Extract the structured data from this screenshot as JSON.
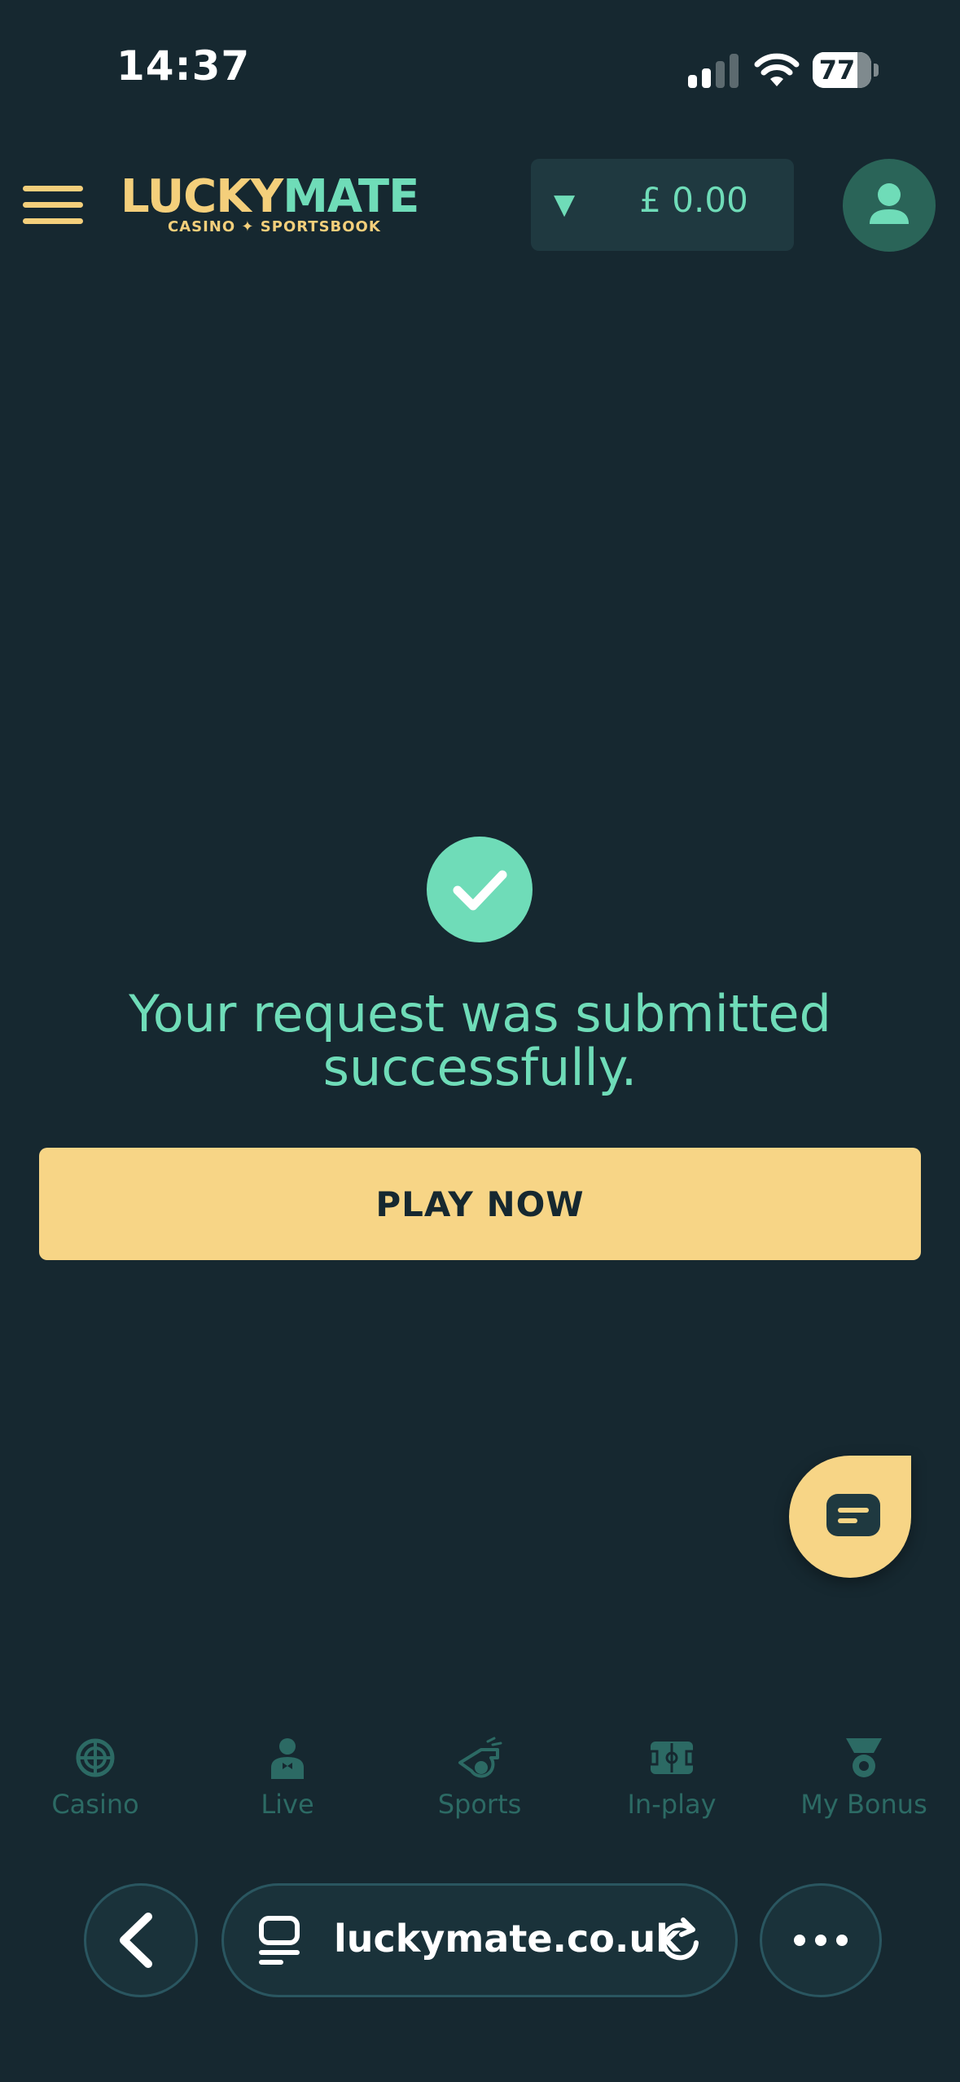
{
  "status_bar": {
    "time": "14:37",
    "battery_level": "77",
    "battery_fraction": 0.77,
    "icons": [
      "signal-icon",
      "wifi-icon",
      "battery-icon"
    ]
  },
  "header": {
    "menu_icon": "hamburger-menu-icon",
    "logo": {
      "lucky": "LUCKY",
      "mate": "MATE",
      "tagline": "CASINO ✦ SPORTSBOOK"
    },
    "balance": {
      "caret": "▼",
      "amount": "£ 0.00"
    },
    "profile_icon": "user-icon"
  },
  "main": {
    "success_icon": "checkmark-icon",
    "message": "Your request was submitted successfully.",
    "play_button": "PLAY NOW"
  },
  "chat": {
    "icon": "chat-icon"
  },
  "bottom_nav": {
    "items": [
      {
        "label": "Casino",
        "icon": "roulette-icon"
      },
      {
        "label": "Live",
        "icon": "dealer-icon"
      },
      {
        "label": "Sports",
        "icon": "whistle-icon"
      },
      {
        "label": "In-play",
        "icon": "pitch-icon"
      },
      {
        "label": "My Bonus",
        "icon": "medal-icon"
      }
    ]
  },
  "browser": {
    "url": "luckymate.co.uk",
    "icons": [
      "back-icon",
      "tabs-icon",
      "reload-icon",
      "more-icon"
    ]
  },
  "colors": {
    "background": "#162830",
    "accent_green": "#6fdcb8",
    "accent_yellow": "#f7d586",
    "nav_inactive": "#2c6a64"
  }
}
